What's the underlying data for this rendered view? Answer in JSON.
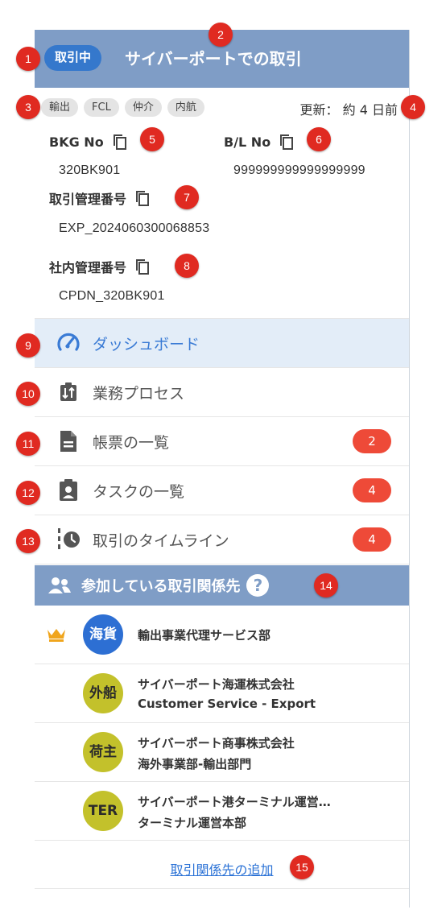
{
  "header": {
    "status": "取引中",
    "title": "サイバーポートでの取引"
  },
  "tags": [
    "輸出",
    "FCL",
    "仲介",
    "内航"
  ],
  "updated": "更新： 約 4 日前",
  "fields": {
    "bkg_label": "BKG No",
    "bkg_value": "320BK901",
    "bl_label": "B/L No",
    "bl_value": "999999999999999999",
    "trade_mgmt_label": "取引管理番号",
    "trade_mgmt_value": "EXP_2024060300068853",
    "internal_mgmt_label": "社内管理番号",
    "internal_mgmt_value": "CPDN_320BK901"
  },
  "menu": [
    {
      "label": "ダッシュボード",
      "icon": "speedometer-icon"
    },
    {
      "label": "業務プロセス",
      "icon": "process-icon"
    },
    {
      "label": "帳票の一覧",
      "icon": "document-icon",
      "count": "2"
    },
    {
      "label": "タスクの一覧",
      "icon": "clipboard-user-icon",
      "count": "4"
    },
    {
      "label": "取引のタイムライン",
      "icon": "timeline-clock-icon",
      "count": "4"
    }
  ],
  "partners": {
    "header": "参加している取引関係先",
    "help": "?",
    "items": [
      {
        "avatar": "海貨",
        "name": "輸出事業代理サービス部",
        "dept": "",
        "owner": true
      },
      {
        "avatar": "外船",
        "name": "サイバーポート海運株式会社",
        "dept": "Customer Service - Export"
      },
      {
        "avatar": "荷主",
        "name": "サイバーポート商事株式会社",
        "dept": "海外事業部-輸出部門"
      },
      {
        "avatar": "TER",
        "name": "サイバーポート港ターミナル運営…",
        "dept": "ターミナル運営本部"
      }
    ],
    "add_link": "取引関係先の追加"
  },
  "markers": [
    "1",
    "2",
    "3",
    "4",
    "5",
    "6",
    "7",
    "8",
    "9",
    "10",
    "11",
    "12",
    "13",
    "14",
    "15"
  ],
  "colors": {
    "header_bg": "#7f9dc6",
    "status_pill": "#3578cc",
    "active_bg": "#e3edf8",
    "badge": "#ee4a38",
    "marker": "#e02a21",
    "avatar_blue": "#2d6fd3",
    "avatar_olive": "#c3c12b",
    "crown": "#f0a51c"
  }
}
